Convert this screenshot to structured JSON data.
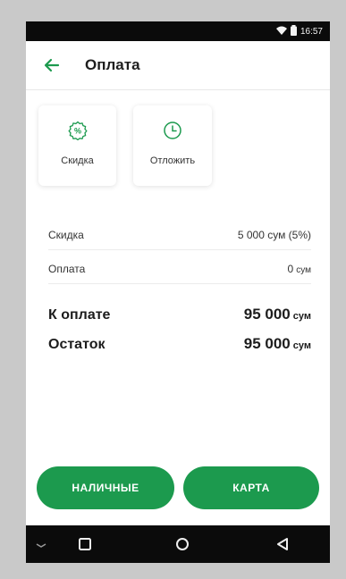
{
  "status": {
    "time": "16:57",
    "icons": [
      "wifi-icon",
      "battery-icon"
    ]
  },
  "header": {
    "title": "Оплата",
    "back_icon": "arrow-left-icon"
  },
  "actions": [
    {
      "label": "Скидка",
      "icon": "percent-badge-icon"
    },
    {
      "label": "Отложить",
      "icon": "clock-icon"
    }
  ],
  "summary": {
    "discount": {
      "label": "Скидка",
      "value": "5 000 сум (5%)"
    },
    "payment": {
      "label": "Оплата",
      "value": "0",
      "unit": "сум"
    },
    "due": {
      "label": "К оплате",
      "value": "95 000",
      "unit": "сум"
    },
    "remaining": {
      "label": "Остаток",
      "value": "95 000",
      "unit": "сум"
    }
  },
  "buttons": {
    "cash": "НАЛИЧНЫЕ",
    "card": "КАРТА"
  },
  "colors": {
    "accent": "#1c9a4e",
    "statusbar": "#0b0b0b"
  },
  "navbar": {
    "icons": [
      "chevron-down-icon",
      "recent-apps-icon",
      "home-icon",
      "back-triangle-icon"
    ]
  }
}
